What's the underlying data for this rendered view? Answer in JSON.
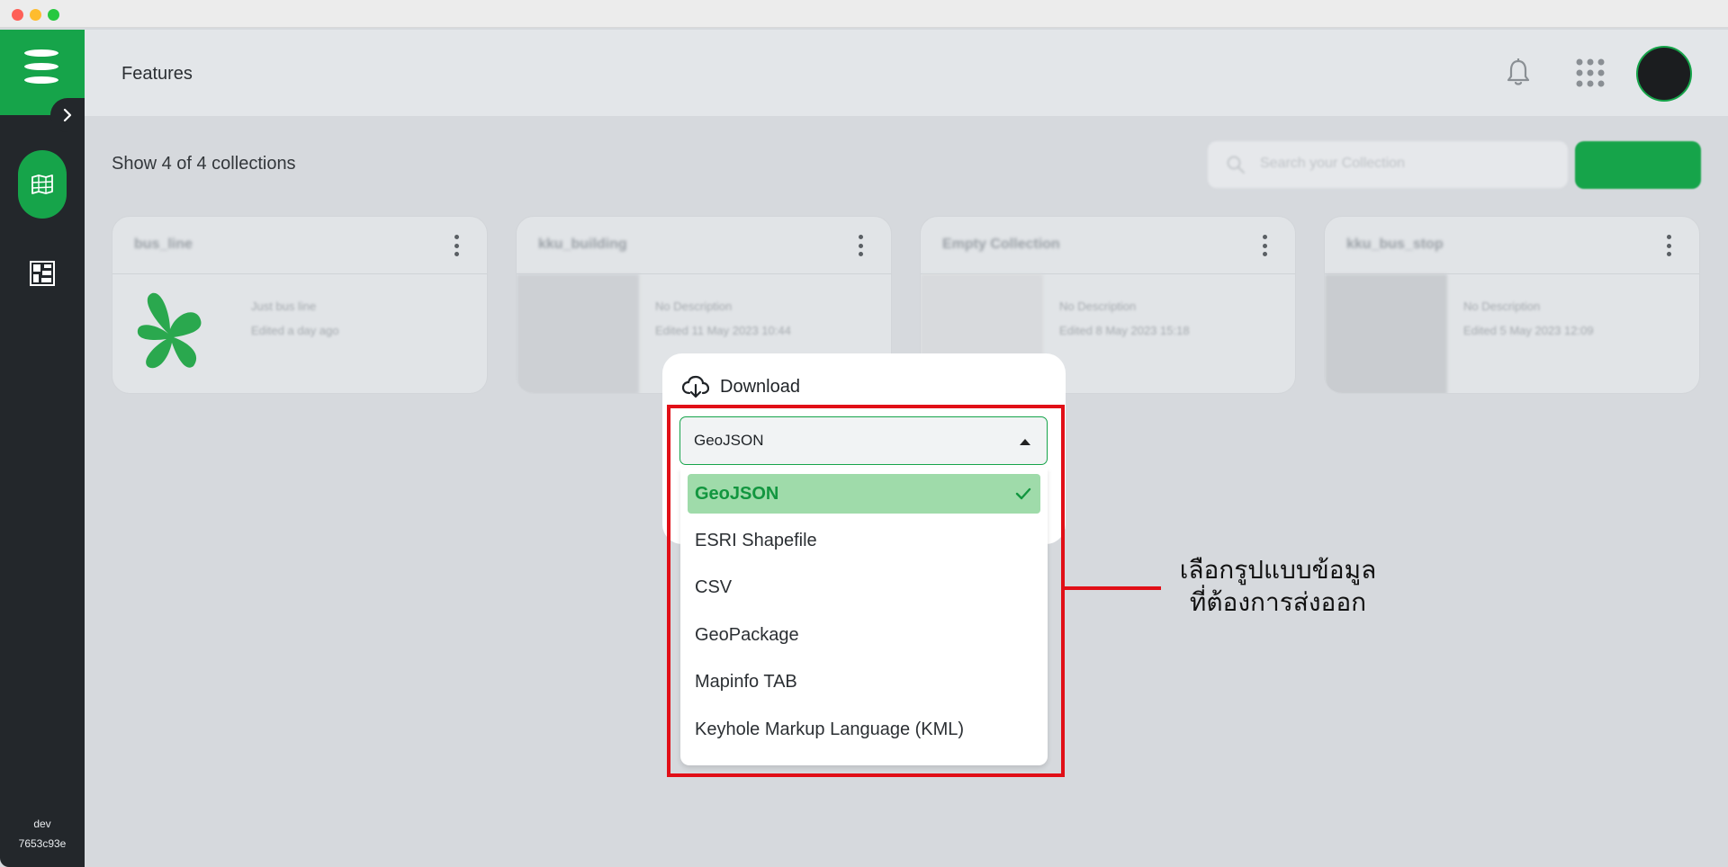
{
  "sidebar": {
    "env_name": "dev",
    "env_hash": "7653c93e",
    "icons": [
      "menu-logo-icon",
      "chevron-right-icon",
      "map-grid-icon",
      "dashboard-icon"
    ],
    "accent": "#16a44a"
  },
  "header": {
    "title": "Features",
    "icons": [
      "bell-icon",
      "apps-grid-icon"
    ]
  },
  "main": {
    "count_text": "Show 4 of 4 collections",
    "search_placeholder": "Search your Collection",
    "cards": [
      {
        "title": "bus_line",
        "desc1": "Just bus line",
        "desc2": "Edited a day ago"
      },
      {
        "title": "kku_building",
        "desc1": "No Description",
        "desc2": "Edited 11 May 2023 10:44"
      },
      {
        "title": "Empty Collection",
        "desc1": "No Description",
        "desc2": "Edited 8 May 2023 15:18"
      },
      {
        "title": "kku_bus_stop",
        "desc1": "No Description",
        "desc2": "Edited 5 May 2023 12:09"
      }
    ]
  },
  "download": {
    "title": "Download",
    "selected": "GeoJSON",
    "options": [
      "GeoJSON",
      "ESRI Shapefile",
      "CSV",
      "GeoPackage",
      "Mapinfo TAB",
      "Keyhole Markup Language (KML)"
    ]
  },
  "annotation": {
    "line1": "เลือกรูปแบบข้อมูล",
    "line2": "ที่ต้องการส่งออก",
    "color": "#e10f17"
  }
}
